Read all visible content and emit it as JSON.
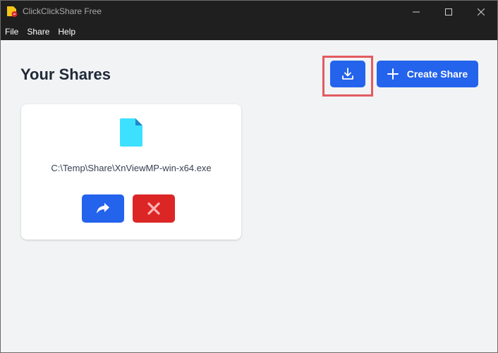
{
  "window": {
    "title": "ClickClickShare Free"
  },
  "menu": {
    "items": [
      "File",
      "Share",
      "Help"
    ]
  },
  "main": {
    "heading": "Your Shares",
    "import_button_icon": "download-icon",
    "create_share_label": "Create Share"
  },
  "shares": [
    {
      "path": "C:\\Temp\\Share\\XnViewMP-win-x64.exe",
      "icon": "file-icon"
    }
  ],
  "colors": {
    "titlebar": "#1f1f1f",
    "primary": "#2463eb",
    "danger": "#dc2626",
    "file_icon": "#3ee0ff",
    "highlight": "#e25b61"
  }
}
